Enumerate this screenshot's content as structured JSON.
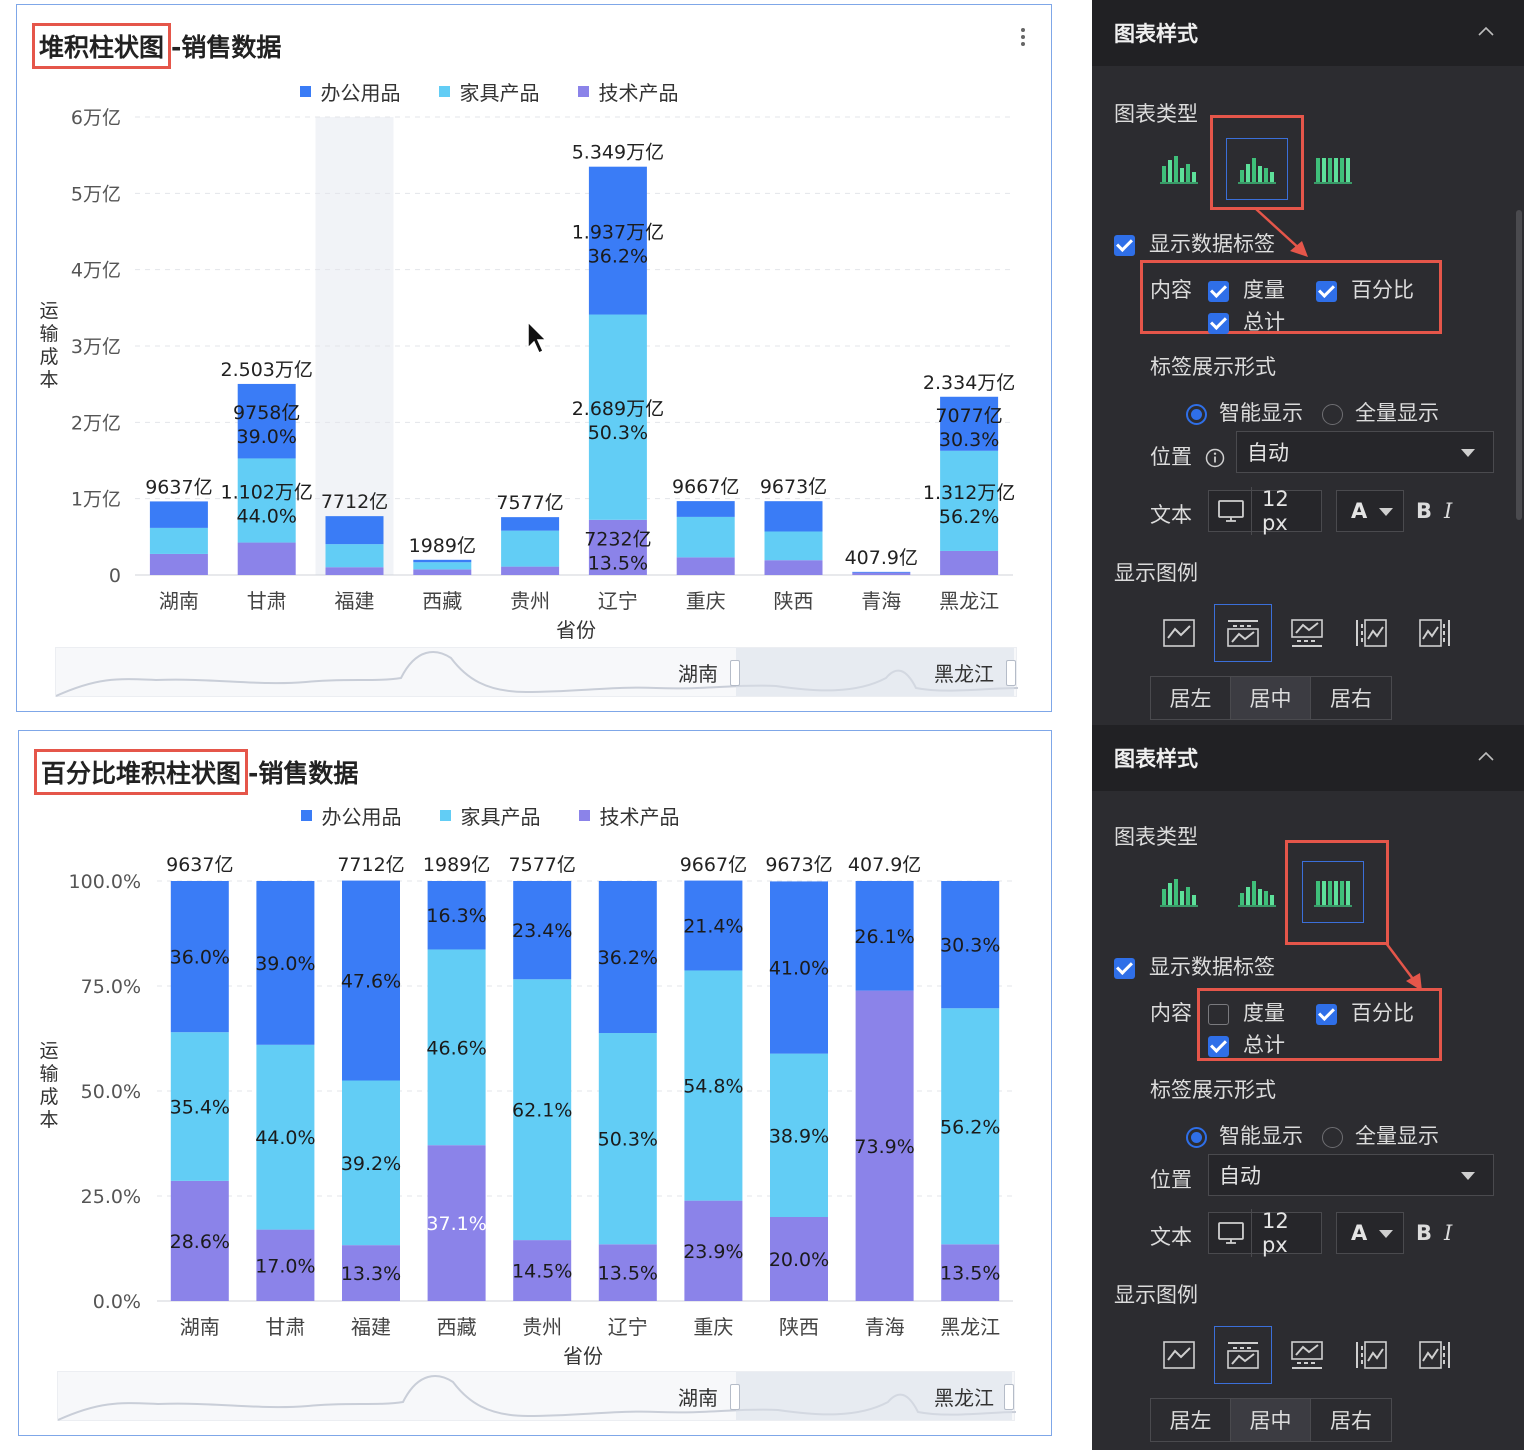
{
  "colors": {
    "office": "#3a7cf6",
    "furniture": "#62cdf5",
    "tech": "#8b83e9",
    "highlight_red": "#e5564a",
    "panel_bg": "#2c2c30",
    "accent_blue": "#2f6fe8"
  },
  "card1": {
    "title_highlight": "堆积柱状图",
    "title_rest": "-销售数据",
    "slider": {
      "start_label": "湖南",
      "end_label": "黑龙江"
    }
  },
  "card2": {
    "title_highlight": "百分比堆积柱状图",
    "title_rest": "-销售数据",
    "slider": {
      "start_label": "湖南",
      "end_label": "黑龙江"
    }
  },
  "legend": [
    "办公用品",
    "家具产品",
    "技术产品"
  ],
  "chart_data": [
    {
      "type": "bar",
      "stacked": true,
      "xlabel": "省份",
      "ylabel": "运输成本",
      "y_ticks": [
        "0",
        "1万亿",
        "2万亿",
        "3万亿",
        "4万亿",
        "5万亿",
        "6万亿"
      ],
      "ylim": [
        0,
        6
      ],
      "y_unit": "万亿",
      "grid": true,
      "legend_position": "top",
      "categories": [
        "湖南",
        "甘肃",
        "福建",
        "西藏",
        "贵州",
        "辽宁",
        "重庆",
        "陕西",
        "青海",
        "黑龙江"
      ],
      "series": [
        {
          "name": "办公用品",
          "values": [
            0.347,
            0.976,
            0.367,
            0.032,
            0.177,
            1.937,
            0.207,
            0.397,
            0.011,
            0.708
          ]
        },
        {
          "name": "家具产品",
          "values": [
            0.341,
            1.102,
            0.302,
            0.093,
            0.471,
            2.689,
            0.53,
            0.376,
            0.0,
            1.312
          ]
        },
        {
          "name": "技术产品",
          "values": [
            0.276,
            0.425,
            0.102,
            0.074,
            0.11,
            0.723,
            0.231,
            0.194,
            0.03,
            0.315
          ]
        }
      ],
      "totals": [
        "9637亿",
        "2.503万亿",
        "7712亿",
        "1989亿",
        "7577亿",
        "5.349万亿",
        "9667亿",
        "9673亿",
        "407.9亿",
        "2.334万亿"
      ],
      "data_labels": [
        {
          "category": "甘肃",
          "series": "办公用品",
          "value": "9758亿",
          "percent": "39.0%"
        },
        {
          "category": "甘肃",
          "series": "家具产品",
          "value": "1.102万亿",
          "percent": "44.0%"
        },
        {
          "category": "辽宁",
          "series": "办公用品",
          "value": "1.937万亿",
          "percent": "36.2%"
        },
        {
          "category": "辽宁",
          "series": "家具产品",
          "value": "2.689万亿",
          "percent": "50.3%"
        },
        {
          "category": "辽宁",
          "series": "技术产品",
          "value": "7232亿",
          "percent": "13.5%"
        },
        {
          "category": "黑龙江",
          "series": "办公用品",
          "value": "7077亿",
          "percent": "30.3%"
        },
        {
          "category": "黑龙江",
          "series": "家具产品",
          "value": "1.312万亿",
          "percent": "56.2%"
        }
      ]
    },
    {
      "type": "bar",
      "stacked": true,
      "percent": true,
      "xlabel": "省份",
      "ylabel": "运输成本",
      "y_ticks": [
        "0.0%",
        "25.0%",
        "50.0%",
        "75.0%",
        "100.0%"
      ],
      "ylim": [
        0,
        100
      ],
      "grid": true,
      "legend_position": "top",
      "categories": [
        "湖南",
        "甘肃",
        "福建",
        "西藏",
        "贵州",
        "辽宁",
        "重庆",
        "陕西",
        "青海",
        "黑龙江"
      ],
      "series": [
        {
          "name": "办公用品",
          "values": [
            36.0,
            39.0,
            47.6,
            16.3,
            23.4,
            36.2,
            21.4,
            41.0,
            26.1,
            30.3
          ]
        },
        {
          "name": "家具产品",
          "values": [
            35.4,
            44.0,
            39.2,
            46.6,
            62.1,
            50.3,
            54.8,
            38.9,
            0.0,
            56.2
          ]
        },
        {
          "name": "技术产品",
          "values": [
            28.6,
            17.0,
            13.3,
            37.1,
            14.5,
            13.5,
            23.9,
            20.0,
            73.9,
            13.5
          ]
        }
      ],
      "labels": [
        [
          "36.0%",
          "39.0%",
          "47.6%",
          "16.3%",
          "23.4%",
          "36.2%",
          "21.4%",
          "41.0%",
          "26.1%",
          "30.3%"
        ],
        [
          "35.4%",
          "44.0%",
          "39.2%",
          "46.6%",
          "62.1%",
          "50.3%",
          "54.8%",
          "38.9%",
          "",
          "56.2%"
        ],
        [
          "28.6%",
          "17.0%",
          "13.3%",
          "37.1%",
          "14.5%",
          "13.5%",
          "23.9%",
          "20.0%",
          "73.9%",
          "13.5%"
        ]
      ],
      "totals": [
        "9637亿",
        "",
        "7712亿",
        "1989亿",
        "7577亿",
        "",
        "9667亿",
        "9673亿",
        "407.9亿",
        ""
      ]
    }
  ],
  "panel1": {
    "header": "图表样式",
    "chart_type_label": "图表类型",
    "show_data_labels": "显示数据标签",
    "content_label": "内容",
    "measure": "度量",
    "percent": "百分比",
    "total": "总计",
    "label_display_mode": "标签展示形式",
    "smart_display": "智能显示",
    "full_display": "全量显示",
    "position_label": "位置",
    "position_value": "自动",
    "text_label": "文本",
    "font_size": "12 px",
    "font_color": "A",
    "bold": "B",
    "italic": "I",
    "show_legend": "显示图例",
    "align_left": "居左",
    "align_center": "居中",
    "align_right": "居右"
  },
  "panel2": {
    "header": "图表样式",
    "chart_type_label": "图表类型",
    "show_data_labels": "显示数据标签",
    "content_label": "内容",
    "measure": "度量",
    "percent": "百分比",
    "total": "总计",
    "label_display_mode": "标签展示形式",
    "smart_display": "智能显示",
    "full_display": "全量显示",
    "position_label": "位置",
    "position_value": "自动",
    "text_label": "文本",
    "font_size": "12 px",
    "font_color": "A",
    "bold": "B",
    "italic": "I",
    "show_legend": "显示图例",
    "align_left": "居左",
    "align_center": "居中",
    "align_right": "居右"
  }
}
